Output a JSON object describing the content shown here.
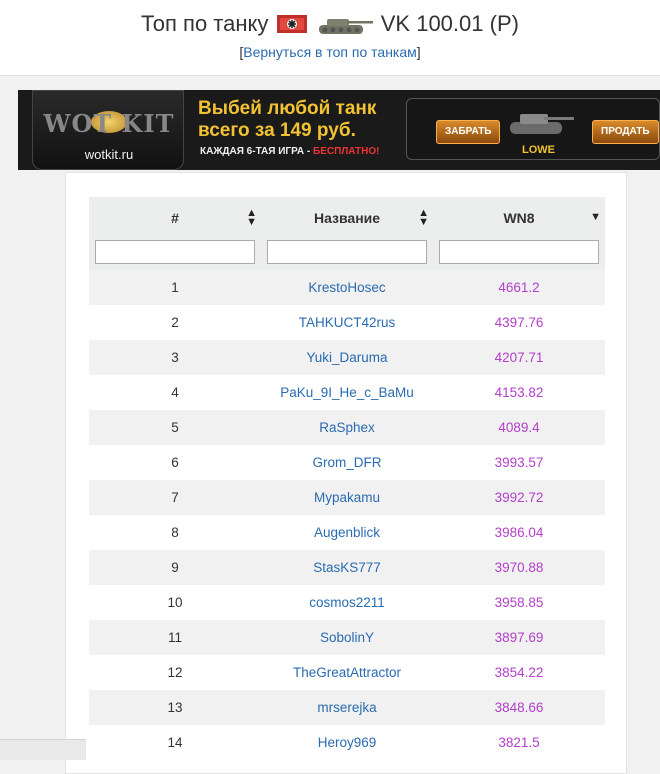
{
  "header": {
    "title_prefix": "Топ по танку",
    "title_tank": "VK 100.01 (P)",
    "back_link": "Вернуться в топ по танкам",
    "bracket_open": "[",
    "bracket_close": "]"
  },
  "banner": {
    "logo_text": "WOT KIT",
    "site": "wotkit.ru",
    "promo_line1": "Выбей любой танк",
    "promo_line2": "всего за 149 руб.",
    "sub_text": "КАЖДАЯ 6-ТАЯ ИГРА - ",
    "sub_free": "БЕСПЛАТНО!",
    "take_button": "ЗАБРАТЬ",
    "buy_button": "ПРОДАТЬ",
    "tank_name": "LOWE"
  },
  "table": {
    "columns": [
      "#",
      "Название",
      "WN8"
    ],
    "rows": [
      {
        "rank": "1",
        "name": "KrestoHosec",
        "wn8": "4661.2"
      },
      {
        "rank": "2",
        "name": "TAHKUCT42rus",
        "wn8": "4397.76"
      },
      {
        "rank": "3",
        "name": "Yuki_Daruma",
        "wn8": "4207.71"
      },
      {
        "rank": "4",
        "name": "PaKu_9I_He_c_BaMu",
        "wn8": "4153.82"
      },
      {
        "rank": "5",
        "name": "RaSphex",
        "wn8": "4089.4"
      },
      {
        "rank": "6",
        "name": "Grom_DFR",
        "wn8": "3993.57"
      },
      {
        "rank": "7",
        "name": "Mypakamu",
        "wn8": "3992.72"
      },
      {
        "rank": "8",
        "name": "Augenblick",
        "wn8": "3986.04"
      },
      {
        "rank": "9",
        "name": "StasKS777",
        "wn8": "3970.88"
      },
      {
        "rank": "10",
        "name": "cosmos2211",
        "wn8": "3958.85"
      },
      {
        "rank": "11",
        "name": "SobolinY",
        "wn8": "3897.69"
      },
      {
        "rank": "12",
        "name": "TheGreatAttractor",
        "wn8": "3854.22"
      },
      {
        "rank": "13",
        "name": "mrserejka",
        "wn8": "3848.66"
      },
      {
        "rank": "14",
        "name": "Heroy969",
        "wn8": "3821.5"
      }
    ]
  },
  "colors": {
    "link": "#2a6bb0",
    "wn8": "#b240c8",
    "accent_gold": "#f2c230"
  }
}
